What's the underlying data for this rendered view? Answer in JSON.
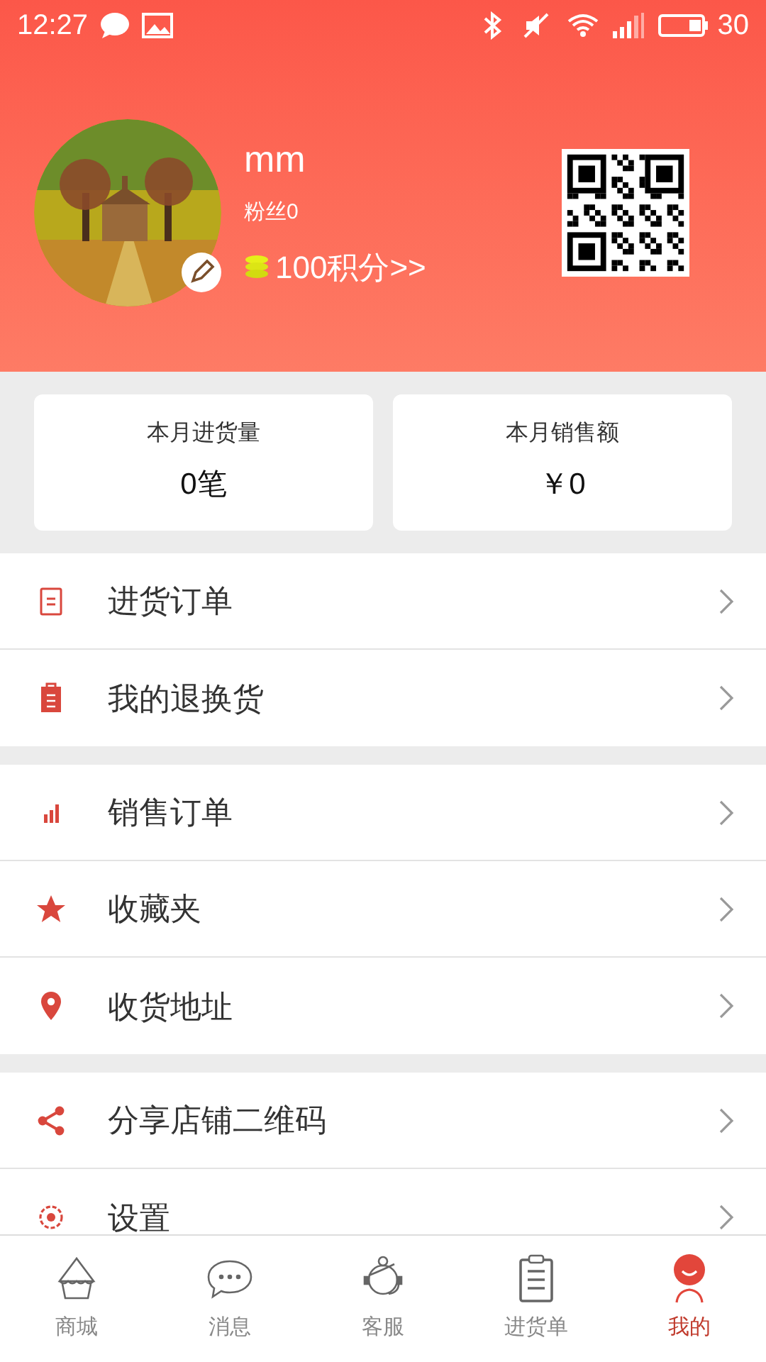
{
  "status_bar": {
    "time": "12:27",
    "battery": "30"
  },
  "profile": {
    "name": "mm",
    "fans": "粉丝0",
    "points": "100积分>>"
  },
  "stats": [
    {
      "label": "本月进货量",
      "value": "0笔"
    },
    {
      "label": "本月销售额",
      "value": "￥0"
    }
  ],
  "menu_groups": [
    [
      {
        "label": "进货订单"
      },
      {
        "label": "我的退换货"
      }
    ],
    [
      {
        "label": "销售订单"
      },
      {
        "label": "收藏夹"
      },
      {
        "label": "收货地址"
      }
    ],
    [
      {
        "label": "分享店铺二维码"
      },
      {
        "label": "设置"
      }
    ]
  ],
  "tab_bar": [
    {
      "label": "商城",
      "selected": false
    },
    {
      "label": "消息",
      "selected": false
    },
    {
      "label": "客服",
      "selected": false
    },
    {
      "label": "进货单",
      "selected": false
    },
    {
      "label": "我的",
      "selected": true
    }
  ]
}
